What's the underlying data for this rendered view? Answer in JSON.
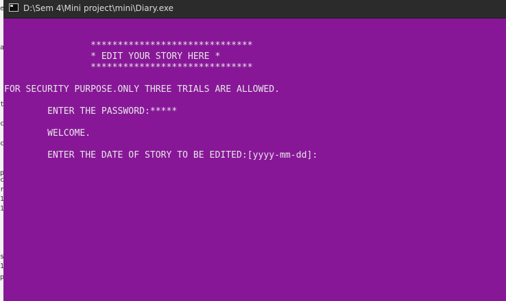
{
  "window": {
    "title": "D:\\Sem 4\\Mini project\\mini\\Diary.exe"
  },
  "console": {
    "lines": [
      "",
      "",
      "                ******************************",
      "                * EDIT YOUR STORY HERE *",
      "                ******************************",
      "",
      "FOR SECURITY PURPOSE.ONLY THREE TRIALS ARE ALLOWED.",
      "",
      "        ENTER THE PASSWORD:*****",
      "",
      "        WELCOME.",
      "",
      "        ENTER THE DATE OF STORY TO BE EDITED:[yyyy-mm-dd]:"
    ]
  },
  "colors": {
    "console_background": "#881798",
    "console_text": "#e6e6e6",
    "titlebar_background": "#2b2b2b"
  }
}
